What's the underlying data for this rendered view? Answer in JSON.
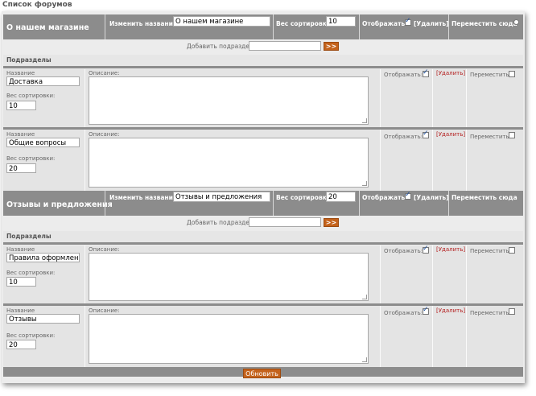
{
  "page_title": "Список форумов",
  "labels": {
    "change_name": "Изменить название:",
    "sort_weight": "Вес сортировки:",
    "display": "Отображать:",
    "delete_bracket": "[Удалить]",
    "move_here": "Переместить сюда",
    "add_subsection": "Добавить подраздел:",
    "add_button": ">>",
    "subsections": "Подразделы",
    "name": "Название",
    "sort_weight_sub": "Вес сортировки:",
    "description": "Описание:",
    "move": "Переместить",
    "update_button": "Обновить"
  },
  "forums": [
    {
      "title": "О нашем магазине",
      "name_value": "О нашем магазине",
      "sort_value": "10",
      "display_checked": true,
      "add_value": "",
      "subsections": [
        {
          "name": "Доставка",
          "sort": "10",
          "description": "",
          "display_checked": true
        },
        {
          "name": "Общие вопросы",
          "sort": "20",
          "description": "",
          "display_checked": true
        }
      ]
    },
    {
      "title": "Отзывы и предложения",
      "name_value": "Отзывы и предложения",
      "sort_value": "20",
      "display_checked": true,
      "add_value": "",
      "subsections": [
        {
          "name": "Правила оформления",
          "sort": "10",
          "description": "",
          "display_checked": true
        },
        {
          "name": "Отзывы",
          "sort": "20",
          "description": "",
          "display_checked": true
        }
      ]
    }
  ]
}
